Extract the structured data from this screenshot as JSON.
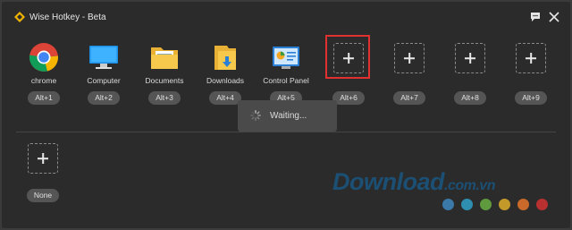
{
  "window": {
    "title": "Wise Hotkey - Beta"
  },
  "slots": [
    {
      "name": "chrome",
      "key": "Alt+1",
      "icon": "chrome-icon"
    },
    {
      "name": "Computer",
      "key": "Alt+2",
      "icon": "computer-icon"
    },
    {
      "name": "Documents",
      "key": "Alt+3",
      "icon": "documents-folder-icon"
    },
    {
      "name": "Downloads",
      "key": "Alt+4",
      "icon": "downloads-folder-icon"
    },
    {
      "name": "Control Panel",
      "key": "Alt+5",
      "icon": "control-panel-icon"
    },
    {
      "name": "",
      "key": "Alt+6",
      "icon": "add-icon"
    },
    {
      "name": "",
      "key": "Alt+7",
      "icon": "add-icon"
    },
    {
      "name": "",
      "key": "Alt+8",
      "icon": "add-icon"
    },
    {
      "name": "",
      "key": "Alt+9",
      "icon": "add-icon"
    }
  ],
  "waiting": {
    "text": "Waiting..."
  },
  "extra_slot": {
    "key": "None",
    "icon": "add-icon"
  },
  "watermark": {
    "text": "Download",
    "suffix": ".com.vn"
  },
  "colors": {
    "background": "#2b2b2b",
    "pill": "#555555",
    "highlight": "#e03030",
    "watermark": "#1c4f74"
  },
  "watermark_dots": [
    "#3a79a8",
    "#2f8fb0",
    "#5f9a3e",
    "#c39a2a",
    "#c96a2a",
    "#b83030"
  ]
}
